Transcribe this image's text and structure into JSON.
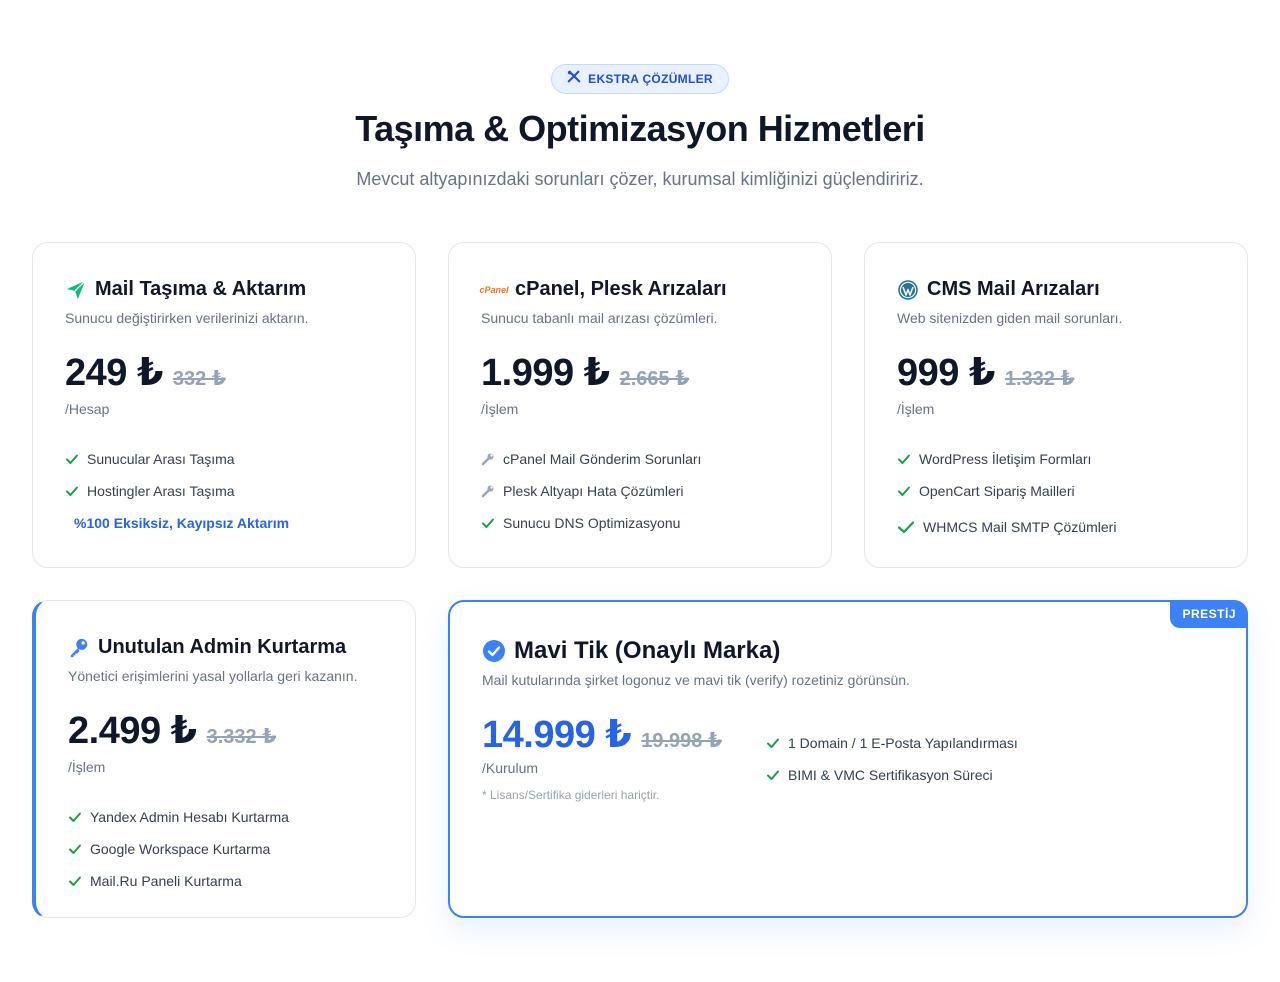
{
  "badge": {
    "label": "EKSTRA ÇÖZÜMLER",
    "icon": "tools-icon"
  },
  "header": {
    "title": "Taşıma & Optimizasyon Hizmetleri",
    "subtitle": "Mevcut altyapınızdaki sorunları çözer, kurumsal kimliğinizi güçlendiririz."
  },
  "colors": {
    "accent": "#3b82f6",
    "check": "#16a34a",
    "send": "#10b981",
    "cpanel": "#f97316"
  },
  "cards": [
    {
      "icon": "send-icon",
      "title": "Mail Taşıma & Aktarım",
      "desc": "Sunucu değiştirirken verilerinizi aktarın.",
      "price": "249 ₺",
      "old_price": "332 ₺",
      "unit": "/Hesap",
      "features": [
        "Sunucular Arası Taşıma",
        "Hostingler Arası Taşıma"
      ],
      "highlight": "%100 Eksiksiz, Kayıpsız Aktarım"
    },
    {
      "icon": "cpanel-logo",
      "logo_text": "cPanel",
      "title": "cPanel, Plesk Arızaları",
      "desc": "Sunucu tabanlı mail arızası çözümleri.",
      "price": "1.999 ₺",
      "old_price": "2.665 ₺",
      "unit": "/İşlem",
      "features": [
        "cPanel Mail Gönderim Sorunları",
        "Plesk Altyapı Hata Çözümleri",
        "Sunucu DNS Optimizasyonu"
      ]
    },
    {
      "icon": "wordpress-icon",
      "title": "CMS Mail Arızaları",
      "desc": "Web sitenizden giden mail sorunları.",
      "price": "999 ₺",
      "old_price": "1.332 ₺",
      "unit": "/İşlem",
      "features": [
        "WordPress İletişim Formları",
        "OpenCart Sipariş Mailleri",
        "WHMCS Mail SMTP Çözümleri"
      ]
    },
    {
      "icon": "key-icon",
      "title": "Unutulan Admin Kurtarma",
      "desc": "Yönetici erişimlerini yasal yollarla geri kazanın.",
      "price": "2.499 ₺",
      "old_price": "3.332 ₺",
      "unit": "/İşlem",
      "features": [
        "Yandex Admin Hesabı Kurtarma",
        "Google Workspace Kurtarma",
        "Mail.Ru Paneli Kurtarma"
      ]
    },
    {
      "icon": "verified-check-icon",
      "ribbon": "PRESTİJ",
      "title": "Mavi Tik (Onaylı Marka)",
      "desc": "Mail kutularında şirket logonuz ve mavi tik (verify) rozetiniz görünsün.",
      "price": "14.999 ₺",
      "old_price": "19.998 ₺",
      "unit": "/Kurulum",
      "note": "* Lisans/Sertifika giderleri hariçtir.",
      "features": [
        "1 Domain / 1 E-Posta Yapılandırması",
        "BIMI & VMC Sertifikasyon Süreci"
      ]
    }
  ]
}
